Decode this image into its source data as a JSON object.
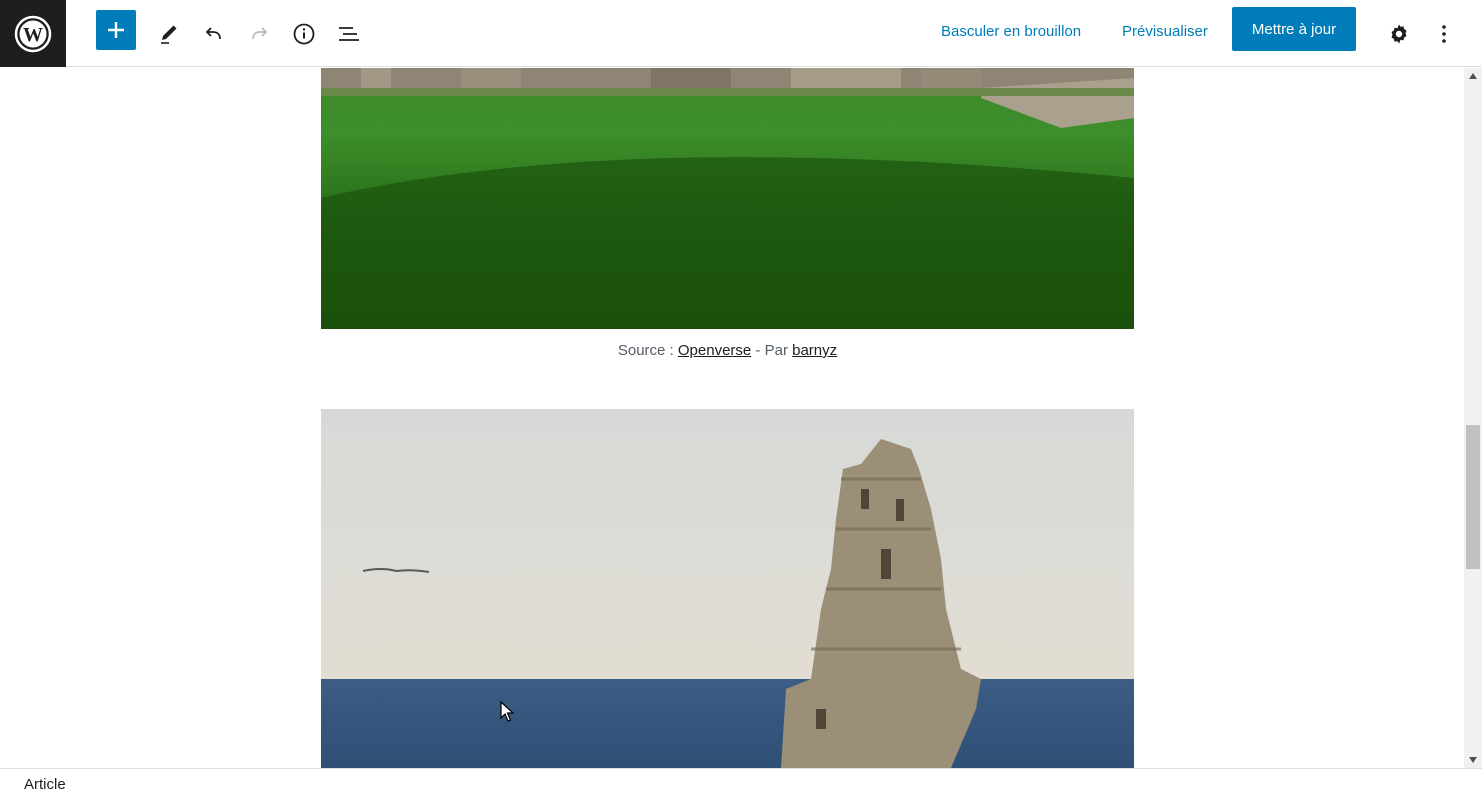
{
  "toolbar": {
    "switch_to_draft_label": "Basculer en brouillon",
    "preview_label": "Prévisualiser",
    "update_label": "Mettre à jour",
    "icons": [
      "wordpress-icon",
      "plus-icon",
      "pencil-icon",
      "undo-icon",
      "redo-icon",
      "info-icon",
      "list-view-icon",
      "gear-icon",
      "more-vertical-icon"
    ]
  },
  "content": {
    "caption": {
      "prefix": "Source : ",
      "source_link": "Openverse",
      "middle": " - Par ",
      "author_link": "barnyz"
    }
  },
  "footer": {
    "breadcrumb": "Article"
  },
  "colors": {
    "accent": "#007cba",
    "logo_background": "#1e1e1e"
  }
}
